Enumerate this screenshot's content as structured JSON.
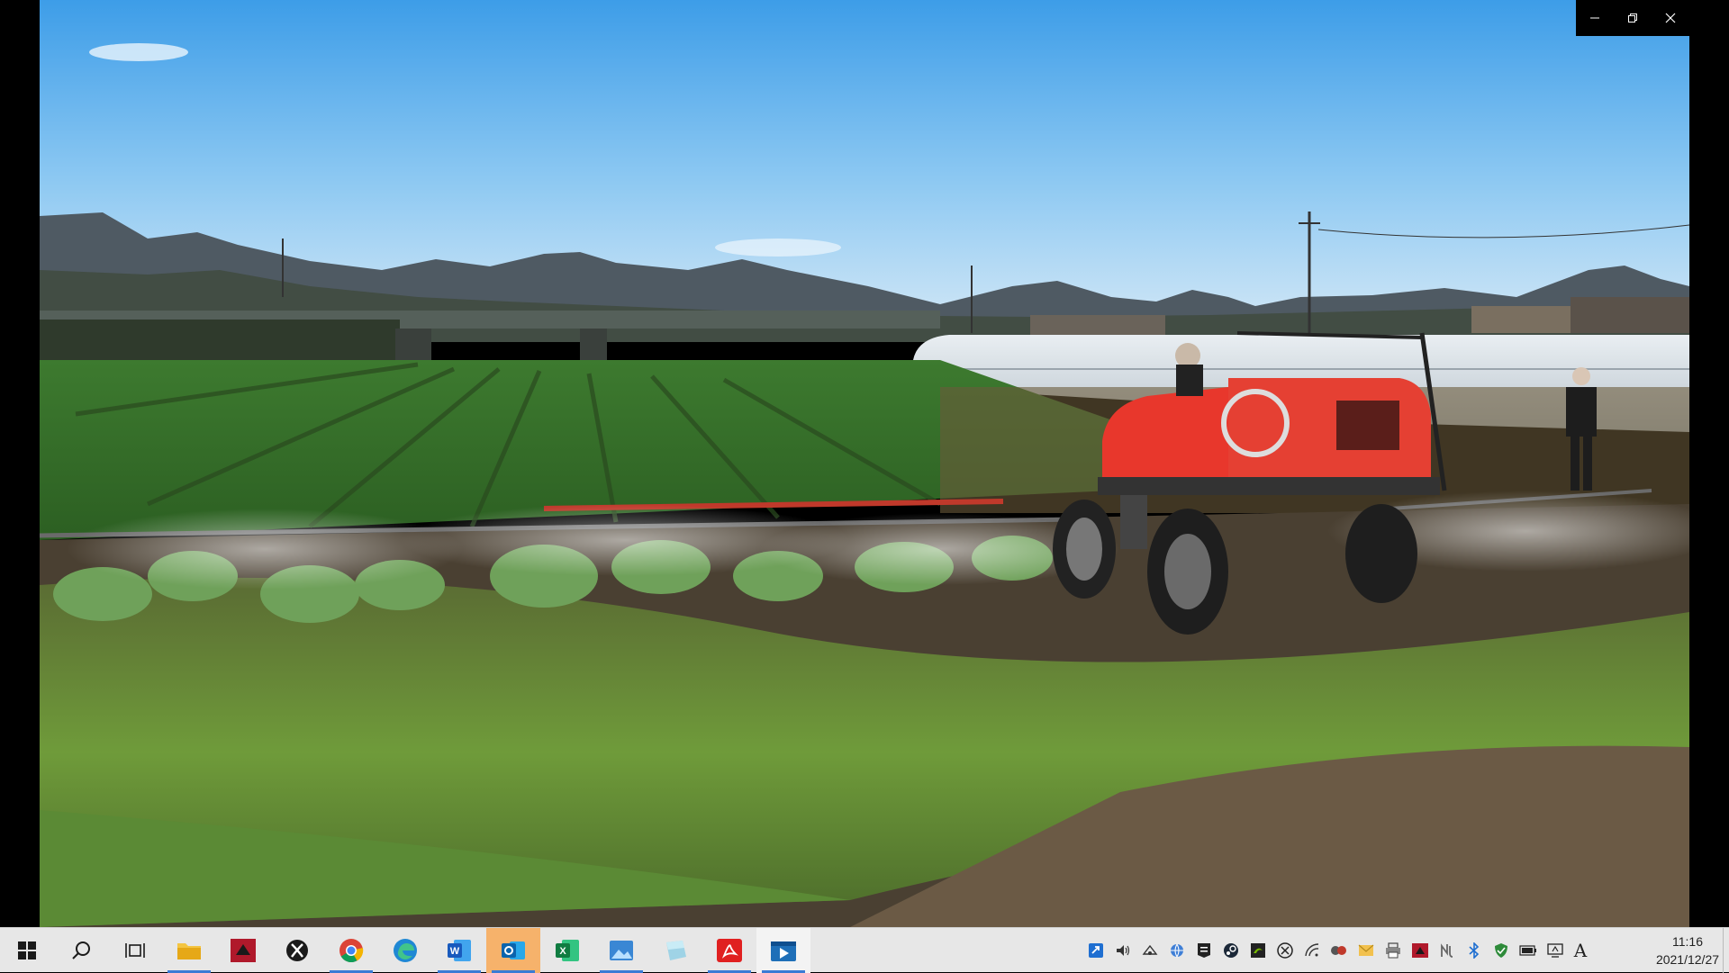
{
  "window": {
    "controls": [
      "minimize",
      "restore",
      "close"
    ]
  },
  "taskbar": {
    "start_icon": "windows-start-icon",
    "search_icon": "search-icon",
    "task_view_icon": "task-view-icon",
    "pinned_apps": [
      {
        "name": "file-explorer",
        "icon": "folder-icon",
        "running": true
      },
      {
        "name": "red-app",
        "icon": "red-app-icon",
        "running": false
      },
      {
        "name": "xbox",
        "icon": "xbox-icon",
        "running": false
      },
      {
        "name": "chrome",
        "icon": "chrome-icon",
        "running": true
      },
      {
        "name": "edge",
        "icon": "edge-icon",
        "running": false
      },
      {
        "name": "word",
        "icon": "word-icon",
        "running": true
      },
      {
        "name": "outlook",
        "icon": "outlook-icon",
        "running": true
      },
      {
        "name": "excel",
        "icon": "excel-icon",
        "running": false
      },
      {
        "name": "photos",
        "icon": "photos-icon",
        "running": true
      },
      {
        "name": "notes",
        "icon": "notes-icon",
        "running": false
      },
      {
        "name": "acrobat",
        "icon": "pdf-icon",
        "running": true
      },
      {
        "name": "media-player",
        "icon": "media-player-icon",
        "running": true
      }
    ],
    "tray_icons": [
      "remote-icon",
      "volume-icon",
      "network-tray-icon",
      "globe-icon",
      "epic-icon",
      "steam-icon",
      "nvidia-icon",
      "xbox-tray-icon",
      "wifi-icon",
      "meeting-icon",
      "mail-icon",
      "printer-icon",
      "red-tray-icon",
      "nu-icon",
      "bluetooth-icon",
      "security-icon",
      "battery-icon",
      "display-icon"
    ],
    "ime": "A",
    "clock": {
      "time": "11:16",
      "date": "2021/12/27"
    }
  },
  "colors": {
    "taskbar_bg": "#e7e7e7",
    "accent": "#3a7bd5",
    "tractor": "#e8372c"
  }
}
